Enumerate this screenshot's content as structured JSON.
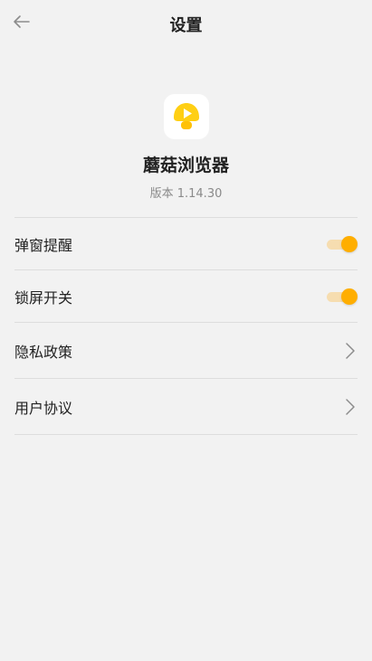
{
  "header": {
    "title": "设置"
  },
  "app": {
    "name": "蘑菇浏览器",
    "version": "版本 1.14.30",
    "icon": "mushroom-play-icon"
  },
  "settings": {
    "popup_reminder": {
      "label": "弹窗提醒",
      "enabled": true
    },
    "lock_screen": {
      "label": "锁屏开关",
      "enabled": true
    },
    "privacy_policy": {
      "label": "隐私政策"
    },
    "user_agreement": {
      "label": "用户协议"
    }
  },
  "colors": {
    "accent": "#ffae00",
    "toggle_track": "#f6ddb0",
    "background": "#f2f2f2",
    "divider": "#dddddd"
  }
}
